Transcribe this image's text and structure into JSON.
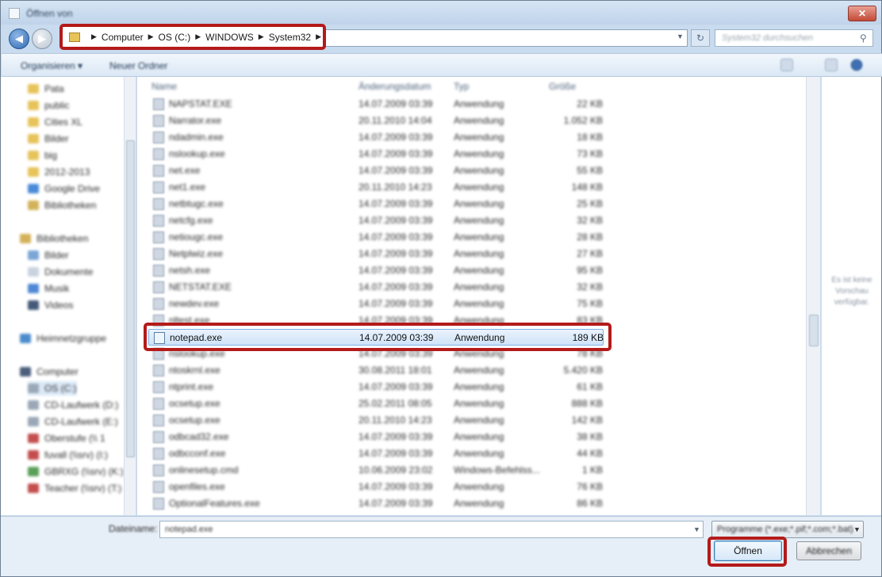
{
  "window": {
    "title": "Öffnen von",
    "close_label": "✕"
  },
  "address": {
    "crumbs": [
      "Computer",
      "OS (C:)",
      "WINDOWS",
      "System32"
    ],
    "search_placeholder": "System32 durchsuchen"
  },
  "toolbar": {
    "organize_label": "Organisieren ▾",
    "new_folder_label": "Neuer Ordner"
  },
  "sidebar": {
    "items": [
      {
        "label": "Pata",
        "color": "#e7c35a"
      },
      {
        "label": "public",
        "color": "#e7c35a"
      },
      {
        "label": "Cities XL",
        "color": "#e7c35a"
      },
      {
        "label": "Bilder",
        "color": "#e7c35a"
      },
      {
        "label": "big",
        "color": "#e7c35a"
      },
      {
        "label": "2012-2013",
        "color": "#e7c35a"
      },
      {
        "label": "Google Drive",
        "color": "#4a8ad8"
      },
      {
        "label": "Bibliotheken",
        "color": "#d4b25a"
      },
      {
        "label": "Bibliotheken",
        "color": "#d4b25a"
      },
      {
        "label": "Bilder",
        "color": "#7aa6d6"
      },
      {
        "label": "Dokumente",
        "color": "#c9d3df"
      },
      {
        "label": "Musik",
        "color": "#4f88d6"
      },
      {
        "label": "Videos",
        "color": "#445a78"
      },
      {
        "label": "Heimnetzgruppe",
        "color": "#4c8ccc"
      },
      {
        "label": "Computer",
        "color": "#4c5e7c"
      },
      {
        "label": "OS (C:)",
        "color": "#9aa7b6"
      },
      {
        "label": "CD-Laufwerk (D:)",
        "color": "#9aa7b6"
      },
      {
        "label": "CD-Laufwerk (E:)",
        "color": "#9aa7b6"
      },
      {
        "label": "Oberstufe (\\\\ 1",
        "color": "#c44d4d"
      },
      {
        "label": "fuvall (\\\\srv) (I:)",
        "color": "#c44d4d"
      },
      {
        "label": "GBRXG (\\\\srv) (K:)",
        "color": "#5aa05a"
      },
      {
        "label": "Teacher (\\\\srv) (T:)",
        "color": "#c44d4d"
      }
    ]
  },
  "filelist": {
    "columns": {
      "name": "Name",
      "date": "Änderungsdatum",
      "type": "Typ",
      "size": "Größe"
    },
    "rows": [
      {
        "name": "NAPSTAT.EXE",
        "date": "14.07.2009 03:39",
        "type": "Anwendung",
        "size": "22 KB"
      },
      {
        "name": "Narrator.exe",
        "date": "20.11.2010 14:04",
        "type": "Anwendung",
        "size": "1.052 KB"
      },
      {
        "name": "ndadmin.exe",
        "date": "14.07.2009 03:39",
        "type": "Anwendung",
        "size": "18 KB"
      },
      {
        "name": "nslookup.exe",
        "date": "14.07.2009 03:39",
        "type": "Anwendung",
        "size": "73 KB"
      },
      {
        "name": "net.exe",
        "date": "14.07.2009 03:39",
        "type": "Anwendung",
        "size": "55 KB"
      },
      {
        "name": "net1.exe",
        "date": "20.11.2010 14:23",
        "type": "Anwendung",
        "size": "148 KB"
      },
      {
        "name": "netbtugc.exe",
        "date": "14.07.2009 03:39",
        "type": "Anwendung",
        "size": "25 KB"
      },
      {
        "name": "netcfg.exe",
        "date": "14.07.2009 03:39",
        "type": "Anwendung",
        "size": "32 KB"
      },
      {
        "name": "netiougc.exe",
        "date": "14.07.2009 03:39",
        "type": "Anwendung",
        "size": "28 KB"
      },
      {
        "name": "Netplwiz.exe",
        "date": "14.07.2009 03:39",
        "type": "Anwendung",
        "size": "27 KB"
      },
      {
        "name": "netsh.exe",
        "date": "14.07.2009 03:39",
        "type": "Anwendung",
        "size": "95 KB"
      },
      {
        "name": "NETSTAT.EXE",
        "date": "14.07.2009 03:39",
        "type": "Anwendung",
        "size": "32 KB"
      },
      {
        "name": "newdev.exe",
        "date": "14.07.2009 03:39",
        "type": "Anwendung",
        "size": "75 KB"
      },
      {
        "name": "nltest.exe",
        "date": "14.07.2009 03:39",
        "type": "Anwendung",
        "size": "83 KB"
      },
      {
        "name": "notepad.exe",
        "date": "14.07.2009 03:39",
        "type": "Anwendung",
        "size": "189 KB",
        "selected": true
      },
      {
        "name": "nslookup.exe",
        "date": "14.07.2009 03:39",
        "type": "Anwendung",
        "size": "78 KB"
      },
      {
        "name": "ntoskrnl.exe",
        "date": "30.08.2011 18:01",
        "type": "Anwendung",
        "size": "5.420 KB"
      },
      {
        "name": "ntprint.exe",
        "date": "14.07.2009 03:39",
        "type": "Anwendung",
        "size": "61 KB"
      },
      {
        "name": "ocsetup.exe",
        "date": "25.02.2011 08:05",
        "type": "Anwendung",
        "size": "888 KB"
      },
      {
        "name": "ocsetup.exe",
        "date": "20.11.2010 14:23",
        "type": "Anwendung",
        "size": "142 KB"
      },
      {
        "name": "odbcad32.exe",
        "date": "14.07.2009 03:39",
        "type": "Anwendung",
        "size": "38 KB"
      },
      {
        "name": "odbcconf.exe",
        "date": "14.07.2009 03:39",
        "type": "Anwendung",
        "size": "44 KB"
      },
      {
        "name": "onlinesetup.cmd",
        "date": "10.06.2009 23:02",
        "type": "Windows-Befehlss...",
        "size": "1 KB"
      },
      {
        "name": "openfiles.exe",
        "date": "14.07.2009 03:39",
        "type": "Anwendung",
        "size": "76 KB"
      },
      {
        "name": "OptionalFeatures.exe",
        "date": "14.07.2009 03:39",
        "type": "Anwendung",
        "size": "86 KB"
      }
    ]
  },
  "preview": {
    "text": "Es ist keine Vorschau verfügbar."
  },
  "bottom": {
    "filename_label": "Dateiname:",
    "filename_value": "notepad.exe",
    "filter_value": "Programme (*.exe;*.pif;*.com;*.bat)",
    "open_label": "Öffnen",
    "cancel_label": "Abbrechen"
  }
}
